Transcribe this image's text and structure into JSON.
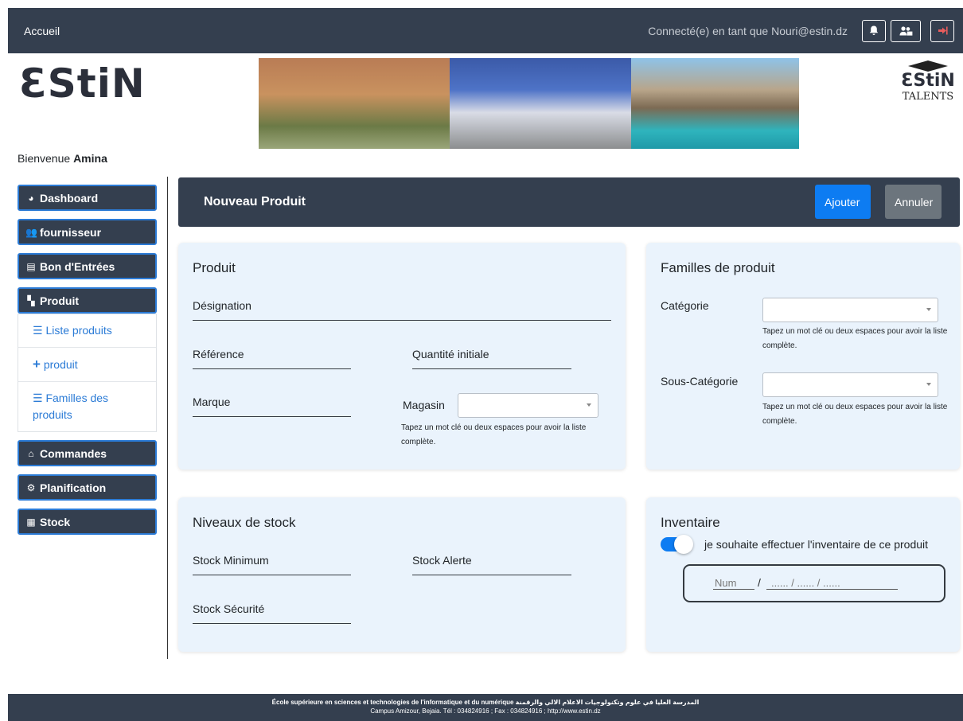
{
  "topbar": {
    "home": "Accueil",
    "connected": "Connecté(e) en tant que Nouri@estin.dz"
  },
  "branding": {
    "logo_text_main": "ƐStiN",
    "logo_right_brand": "ƐStiN",
    "logo_right_sub": "TALENTS"
  },
  "welcome": {
    "prefix": "Bienvenue",
    "name": "Amina"
  },
  "sidebar": {
    "items": [
      {
        "label": "Dashboard"
      },
      {
        "label": "fournisseur"
      },
      {
        "label": "Bon d'Entrées"
      },
      {
        "label": "Produit"
      },
      {
        "label": "Commandes"
      },
      {
        "label": "Planification"
      },
      {
        "label": "Stock"
      }
    ],
    "produit_sub": [
      {
        "label": "Liste produits"
      },
      {
        "label": "produit"
      },
      {
        "label": "Familles des produits"
      }
    ]
  },
  "header": {
    "title": "Nouveau Produit",
    "add_label": "Ajouter",
    "cancel_label": "Annuler"
  },
  "produit_card": {
    "title": "Produit",
    "designation": "Désignation",
    "reference": "Référence",
    "quantite": "Quantité initiale",
    "marque": "Marque",
    "magasin": "Magasin",
    "help": "Tapez un mot clé ou deux espaces pour avoir la liste complète."
  },
  "familles_card": {
    "title": "Familles de produit",
    "categorie": "Catégorie",
    "sous_categorie": "Sous-Catégorie",
    "help1": "Tapez un mot clé ou deux espaces pour avoir la liste complète.",
    "help2": "Tapez un mot clé ou deux espaces pour avoir la liste complète."
  },
  "stock_card": {
    "title": "Niveaux de stock",
    "min": "Stock Minimum",
    "alerte": "Stock Alerte",
    "securite": "Stock Sécurité"
  },
  "inventaire_card": {
    "title": "Inventaire",
    "toggle_label": "je souhaite effectuer l'inventaire de ce produit",
    "toggle_on": true,
    "num_placeholder": "Num",
    "separator": "/",
    "date_placeholder": "...... / ...... / ......"
  },
  "footer": {
    "line1_fr": "École supérieure en sciences et technologies de l'informatique et du numérique",
    "line1_ar": "المدرسة العليا في علوم وتكنولوجيات الاعلام الالي والرقمنة",
    "line2": "Campus Amizour, Bejaia. Tél : 034824916 ; Fax : 034824916 ; http://www.estin.dz"
  },
  "colors": {
    "navy": "#343f4f",
    "primary": "#0d7cf2",
    "secondary": "#6c757d",
    "card_bg": "#eaf3fc",
    "link": "#2b7bd6",
    "brand_red": "#d2232a"
  },
  "icons": {
    "topbar": [
      "bell-icon",
      "users-icon",
      "logout-icon"
    ],
    "sidebar": [
      "chart-pie-icon",
      "users-icon",
      "file-icon",
      "boxes-icon",
      "basket-icon",
      "cogs-icon",
      "warehouse-icon"
    ],
    "submenu": [
      "list-icon",
      "plus-icon",
      "list-icon"
    ]
  }
}
